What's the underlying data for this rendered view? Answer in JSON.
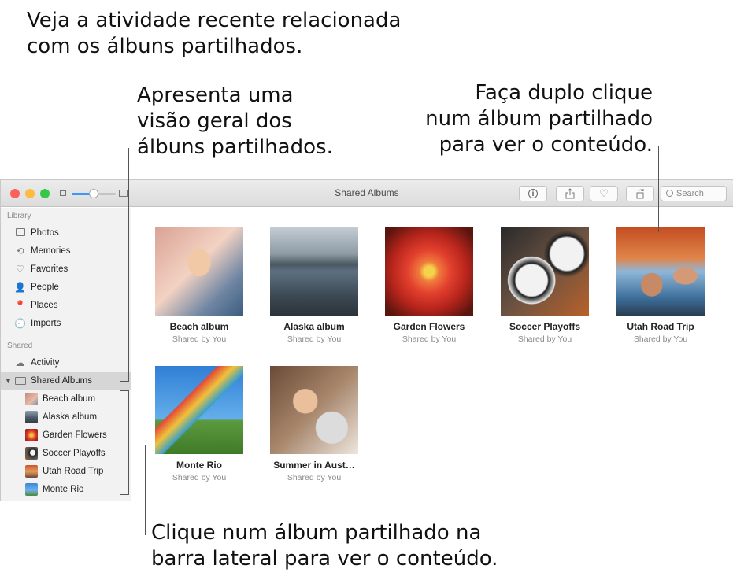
{
  "callouts": {
    "activity": [
      "Veja a atividade recente relacionada",
      "com os álbuns partilhados."
    ],
    "overview": [
      "Apresenta uma",
      "visão geral dos",
      "álbuns partilhados."
    ],
    "double_click": [
      "Faça duplo clique",
      "num álbum partilhado",
      "para ver o conteúdo."
    ],
    "sidebar_click": [
      "Clique num álbum partilhado na",
      "barra lateral para ver o conteúdo."
    ]
  },
  "window": {
    "title": "Shared Albums",
    "search_placeholder": "Search",
    "toolbar_icons": [
      "info-icon",
      "share-icon",
      "heart-icon",
      "rotate-icon"
    ]
  },
  "sidebar": {
    "library_header": "Library",
    "library_items": [
      {
        "label": "Photos",
        "icon": "photos-icon"
      },
      {
        "label": "Memories",
        "icon": "memories-icon"
      },
      {
        "label": "Favorites",
        "icon": "heart-icon"
      },
      {
        "label": "People",
        "icon": "person-icon"
      },
      {
        "label": "Places",
        "icon": "pin-icon"
      },
      {
        "label": "Imports",
        "icon": "clock-icon"
      }
    ],
    "shared_header": "Shared",
    "shared_items": [
      {
        "label": "Activity",
        "icon": "cloud-icon"
      },
      {
        "label": "Shared Albums",
        "icon": "folder-icon",
        "selected": true
      }
    ],
    "albums": [
      "Beach album",
      "Alaska album",
      "Garden Flowers",
      "Soccer Playoffs",
      "Utah Road Trip",
      "Monte Rio"
    ]
  },
  "albums": [
    {
      "name": "Beach album",
      "shared_by": "Shared by You"
    },
    {
      "name": "Alaska album",
      "shared_by": "Shared by You"
    },
    {
      "name": "Garden Flowers",
      "shared_by": "Shared by You"
    },
    {
      "name": "Soccer Playoffs",
      "shared_by": "Shared by You"
    },
    {
      "name": "Utah Road Trip",
      "shared_by": "Shared by You"
    },
    {
      "name": "Monte Rio",
      "shared_by": "Shared by You"
    },
    {
      "name": "Summer in Aust…",
      "shared_by": "Shared by You"
    }
  ],
  "colors": {
    "close": "#fc605c",
    "minimize": "#fdbc40",
    "zoom": "#34c84a",
    "slider_accent": "#3b99fc"
  }
}
